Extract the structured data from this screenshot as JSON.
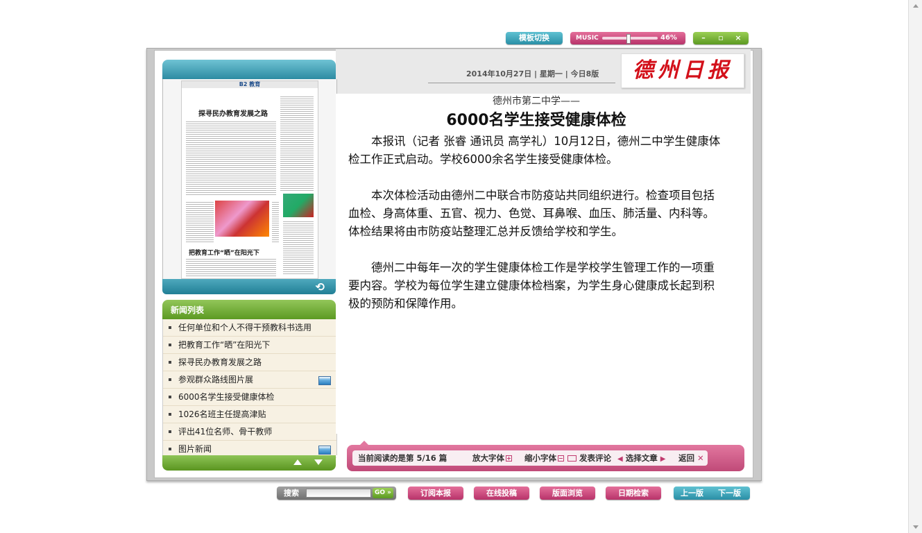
{
  "topbar": {
    "template_switch": "模板切换",
    "music_label": "MUSIC",
    "music_volume_text": "46%",
    "music_volume": 46,
    "win_min": "–",
    "win_max": "▫",
    "win_close": "×"
  },
  "masthead": {
    "date_line": "2014年10月27日 | 星期一 | 今日8版",
    "logo_text": "德州日报"
  },
  "thumbnail": {
    "page_label": "B2 教育",
    "headline": "探寻民办教育发展之路",
    "headline2": "把教育工作“晒”在阳光下"
  },
  "news_list": {
    "title": "新闻列表",
    "items": [
      {
        "label": "任何单位和个人不得干预教科书选用",
        "has_image": false
      },
      {
        "label": "把教育工作“晒”在阳光下",
        "has_image": false
      },
      {
        "label": "探寻民办教育发展之路",
        "has_image": false
      },
      {
        "label": "参观群众路线图片展",
        "has_image": true
      },
      {
        "label": "6000名学生接受健康体检",
        "has_image": false
      },
      {
        "label": "1026名班主任提高津贴",
        "has_image": false
      },
      {
        "label": "评出41位名师、骨干教师",
        "has_image": false
      },
      {
        "label": "图片新闻",
        "has_image": true
      }
    ]
  },
  "article": {
    "kicker": "德州市第二中学——",
    "title": "6000名学生接受健康体检",
    "paragraphs": [
      "本报讯（记者 张睿 通讯员 高学礼）10月12日，德州二中学生健康体检工作正式启动。学校6000余名学生接受健康体检。",
      "本次体检活动由德州二中联合市防疫站共同组织进行。检查项目包括血检、身高体重、五官、视力、色觉、耳鼻喉、血压、肺活量、内科等。体检结果将由市防疫站整理汇总并反馈给学校和学生。",
      "德州二中每年一次的学生健康体检工作是学校学生管理工作的一项重要内容。学校为每位学生建立健康体检档案，为学生身心健康成长起到积极的预防和保障作用。"
    ]
  },
  "reading_bar": {
    "current": "当前阅读的是第 5/16 篇",
    "zoom_in": "放大字体",
    "zoom_out": "缩小字体",
    "comment": "发表评论",
    "select": "选择文章",
    "back": "返回"
  },
  "bottom": {
    "search_label": "搜索",
    "search_value": "",
    "go": "GO »",
    "subscribe": "订阅本报",
    "submit": "在线投稿",
    "browse": "版面浏览",
    "date_search": "日期检索",
    "prev": "上一版",
    "next": "下一版"
  },
  "colors": {
    "accent_teal": "#2a8fa6",
    "accent_pink": "#c04a78",
    "accent_green": "#5c9a22",
    "logo_red": "#d3101a"
  }
}
